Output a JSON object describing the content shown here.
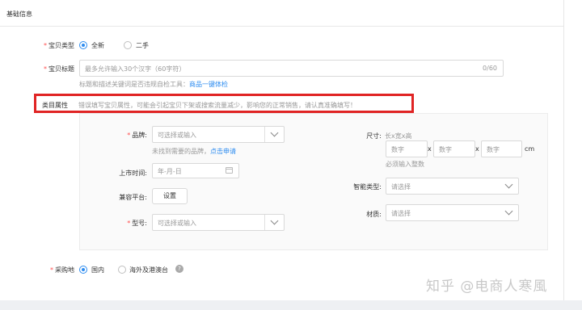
{
  "section": {
    "title": "基础信息"
  },
  "item_type": {
    "label": "宝贝类型",
    "options": [
      {
        "label": "全新",
        "selected": true
      },
      {
        "label": "二手",
        "selected": false
      }
    ]
  },
  "item_title": {
    "label": "宝贝标题",
    "placeholder": "最多允许输入30个汉字（60字符）",
    "counter": "0/60",
    "hint_text": "标题和描述关键词是否违规自检工具：",
    "hint_link": "商品一键体检"
  },
  "category_attrs": {
    "label": "类目属性",
    "warning": "错误填写宝贝属性，可能会引起宝贝下架或搜索流量减少，影响您的正常销售，请认真准确填写！",
    "brand": {
      "label": "品牌",
      "placeholder": "可选择或输入",
      "hint_text": "未找到需要的品牌，",
      "hint_link": "点击申请"
    },
    "release_date": {
      "label": "上市时间",
      "placeholder": "年-月-日"
    },
    "platform": {
      "label": "兼容平台",
      "button": "设置"
    },
    "model": {
      "label": "型号",
      "placeholder": "可选择或输入"
    },
    "size": {
      "label": "尺寸",
      "format": "长x宽x高",
      "placeholders": [
        "数字",
        "数字",
        "数字"
      ],
      "x_sep": "x",
      "unit": "cm",
      "hint": "必须输入整数"
    },
    "smart_type": {
      "label": "智能类型",
      "placeholder": "请选择"
    },
    "material": {
      "label": "材质",
      "placeholder": "请选择"
    }
  },
  "purchase_place": {
    "label": "采购地",
    "options": [
      {
        "label": "国内",
        "selected": true
      },
      {
        "label": "海外及港澳台",
        "selected": false
      }
    ],
    "help_icon": "?"
  },
  "watermark": "知乎 @电商人寒風",
  "colors": {
    "accent": "#2d8cf0",
    "required": "#ff4f4f",
    "highlight": "#e02424"
  }
}
